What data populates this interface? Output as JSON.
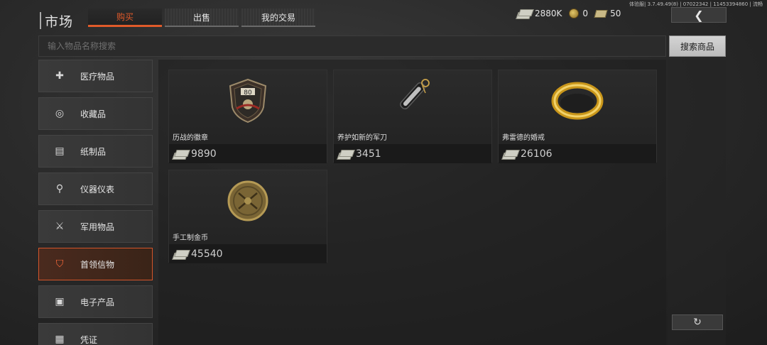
{
  "version_text": "体验服| 3.7.49.49(8) | 07022342 | 11453394860 | 流畅",
  "header": {
    "title": "市场",
    "tabs": [
      {
        "label": "购买",
        "active": true
      },
      {
        "label": "出售",
        "active": false
      },
      {
        "label": "我的交易",
        "active": false
      }
    ]
  },
  "currencies": [
    {
      "icon": "cash-icon",
      "value": "2880K"
    },
    {
      "icon": "coin-icon",
      "value": "0"
    },
    {
      "icon": "ticket-icon",
      "value": "50"
    }
  ],
  "back_button": {
    "icon": "chevron-left-icon",
    "glyph": "❮"
  },
  "search": {
    "placeholder": "输入物品名称搜索",
    "button_label": "搜索商品"
  },
  "sidebar": {
    "items": [
      {
        "label": "医疗物品",
        "icon": "medical-icon",
        "glyph": "✚",
        "active": false
      },
      {
        "label": "收藏品",
        "icon": "collectible-icon",
        "glyph": "◎",
        "active": false
      },
      {
        "label": "纸制品",
        "icon": "paper-icon",
        "glyph": "▤",
        "active": false
      },
      {
        "label": "仪器仪表",
        "icon": "instrument-icon",
        "glyph": "⚲",
        "active": false
      },
      {
        "label": "军用物品",
        "icon": "military-icon",
        "glyph": "⚔",
        "active": false
      },
      {
        "label": "首领信物",
        "icon": "boss-token-icon",
        "glyph": "⛉",
        "active": true
      },
      {
        "label": "电子产品",
        "icon": "electronics-icon",
        "glyph": "▣",
        "active": false
      },
      {
        "label": "凭证",
        "icon": "voucher-icon",
        "glyph": "▦",
        "active": false
      }
    ]
  },
  "items": [
    {
      "name": "历战的徽章",
      "price": "9890",
      "icon": "badge-icon"
    },
    {
      "name": "养护如新的军刀",
      "price": "3451",
      "icon": "knife-icon"
    },
    {
      "name": "弗雷德的婚戒",
      "price": "26106",
      "icon": "ring-icon"
    },
    {
      "name": "手工制金币",
      "price": "45540",
      "icon": "gold-coin-icon"
    }
  ],
  "badge_text": "80",
  "refresh_button": {
    "icon": "refresh-icon",
    "glyph": "↻"
  },
  "colors": {
    "accent": "#e05a2a",
    "background": "#2b2b2b"
  }
}
